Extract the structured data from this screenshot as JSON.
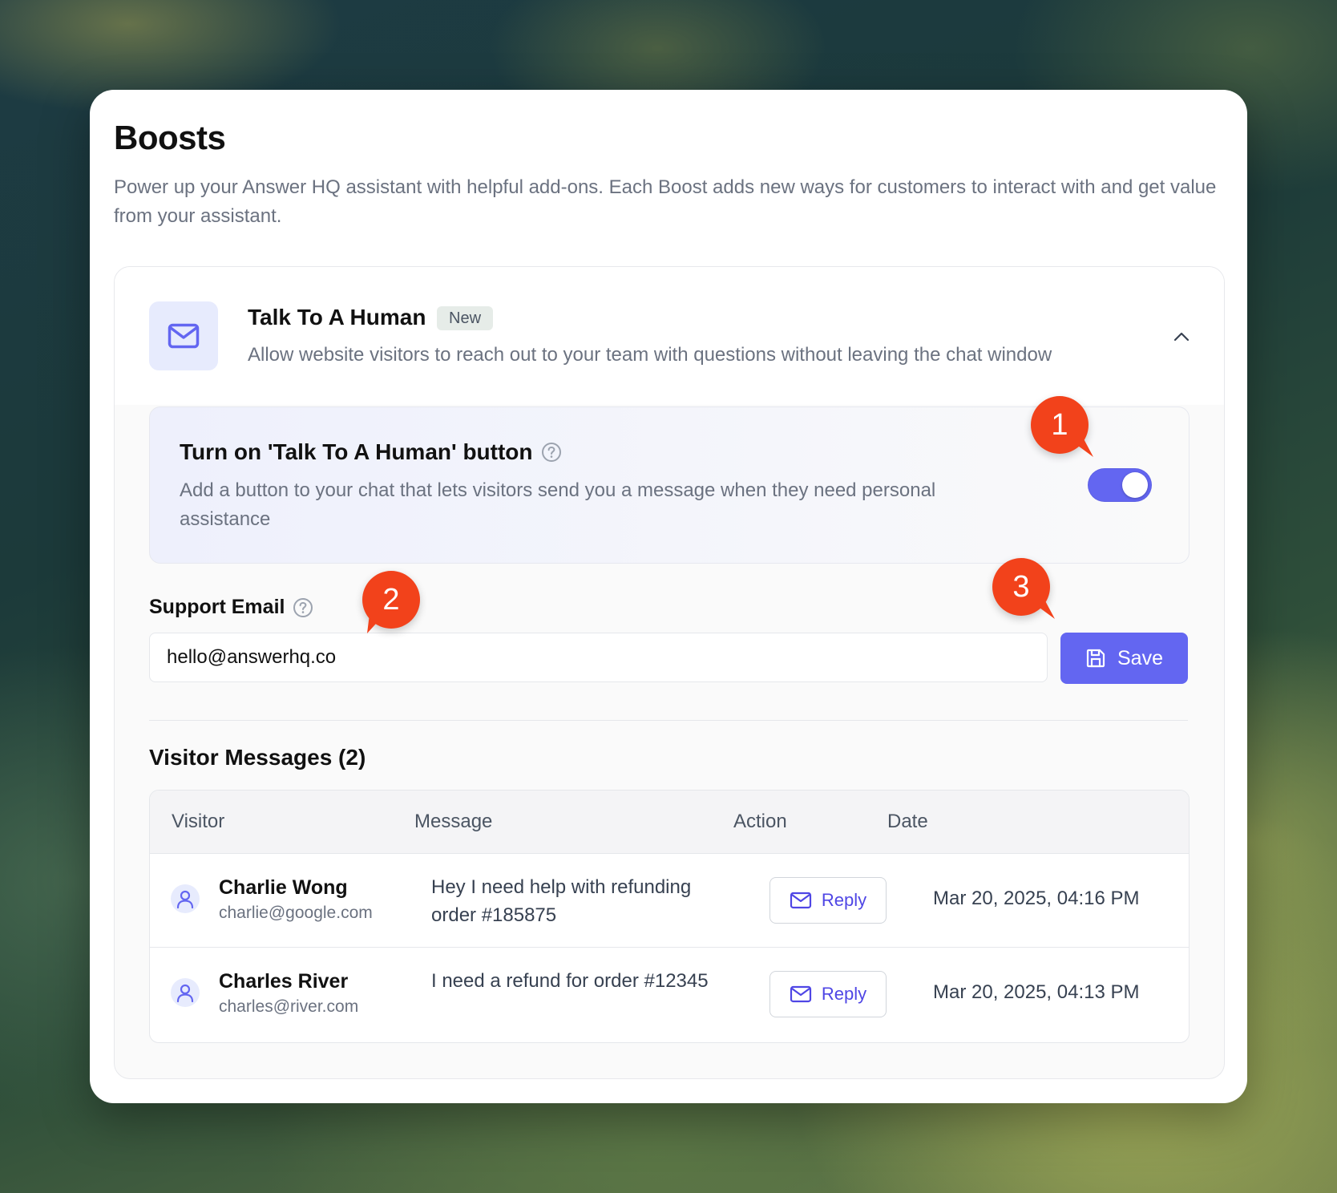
{
  "page": {
    "title": "Boosts",
    "description": "Power up your Answer HQ assistant with helpful add-ons. Each Boost adds new ways for customers to interact with and get value from your assistant."
  },
  "boost": {
    "name": "Talk To A Human",
    "badge": "New",
    "description": "Allow website visitors to reach out to your team with questions without leaving the chat window",
    "icon": "mail-icon",
    "expanded": true
  },
  "toggle_setting": {
    "title": "Turn on 'Talk To A Human' button",
    "description": "Add a button to your chat that lets visitors send you a message when they need personal assistance",
    "enabled": true
  },
  "support_email": {
    "label": "Support Email",
    "value": "hello@answerhq.co",
    "save_label": "Save"
  },
  "messages": {
    "title": "Visitor Messages (2)",
    "columns": [
      "Visitor",
      "Message",
      "Action",
      "Date"
    ],
    "rows": [
      {
        "name": "Charlie Wong",
        "email": "charlie@google.com",
        "message": "Hey I need help with refunding order #185875",
        "action": "Reply",
        "date": "Mar 20, 2025, 04:16 PM"
      },
      {
        "name": "Charles River",
        "email": "charles@river.com",
        "message": "I need a refund for order #12345",
        "action": "Reply",
        "date": "Mar 20, 2025, 04:13 PM"
      }
    ]
  },
  "callouts": [
    "1",
    "2",
    "3"
  ],
  "colors": {
    "accent": "#6366f1",
    "callout": "#f2421b",
    "badge_bg": "#e6ece8"
  }
}
